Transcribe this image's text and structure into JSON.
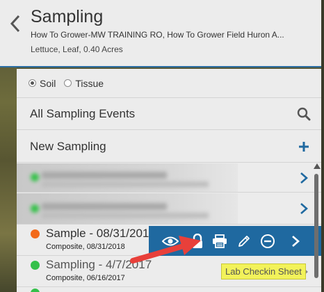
{
  "header": {
    "title": "Sampling",
    "subtitle": "How To Grower-MW TRAINING RO, How To Grower Field Huron A...",
    "crop": "Lettuce, Leaf, 0.40 Acres"
  },
  "type_selector": {
    "options": [
      {
        "label": "Soil",
        "selected": true
      },
      {
        "label": "Tissue",
        "selected": false
      }
    ]
  },
  "menu": {
    "all_events": "All Sampling Events",
    "new_sampling": "New Sampling"
  },
  "samples": [
    {
      "title": "Sample - 08/31/201",
      "subtitle": "Composite, 08/31/2018",
      "status_color": "#f26a1b"
    },
    {
      "title": "Sampling - 4/7/2017",
      "subtitle": "Composite, 06/16/2017",
      "status_color": "#35c04a"
    }
  ],
  "blurred_rows": [
    {
      "status_color": "#36c24a"
    },
    {
      "status_color": "#36c24a"
    }
  ],
  "toolbar": {
    "actions": [
      "view-icon",
      "lock-icon",
      "print-icon",
      "edit-icon",
      "remove-icon",
      "chevron-right-icon"
    ]
  },
  "tooltip": "Lab Checkin Sheet",
  "colors": {
    "accent": "#1f69a0",
    "highlight": "#f2f25a",
    "annotation_arrow": "#e8403a"
  }
}
